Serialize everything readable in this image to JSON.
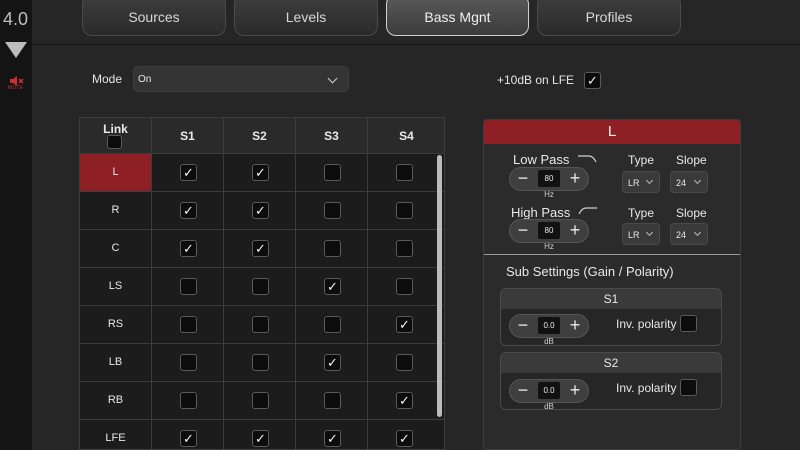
{
  "app": {
    "version": "4.0",
    "mute_label": "MUTE"
  },
  "tabs": [
    {
      "label": "Sources",
      "active": false
    },
    {
      "label": "Levels",
      "active": false
    },
    {
      "label": "Bass Mgnt",
      "active": true
    },
    {
      "label": "Profiles",
      "active": false
    }
  ],
  "mode": {
    "label": "Mode",
    "value": "On"
  },
  "lfe_boost": {
    "label": "+10dB on LFE",
    "checked": true
  },
  "grid": {
    "link_label": "Link",
    "columns": [
      "S1",
      "S2",
      "S3",
      "S4"
    ],
    "rows": [
      {
        "label": "L",
        "selected": true,
        "checks": [
          true,
          true,
          false,
          false
        ]
      },
      {
        "label": "R",
        "selected": false,
        "checks": [
          true,
          true,
          false,
          false
        ]
      },
      {
        "label": "C",
        "selected": false,
        "checks": [
          true,
          true,
          false,
          false
        ]
      },
      {
        "label": "LS",
        "selected": false,
        "checks": [
          false,
          false,
          true,
          false
        ]
      },
      {
        "label": "RS",
        "selected": false,
        "checks": [
          false,
          false,
          false,
          true
        ]
      },
      {
        "label": "LB",
        "selected": false,
        "checks": [
          false,
          false,
          true,
          false
        ]
      },
      {
        "label": "RB",
        "selected": false,
        "checks": [
          false,
          false,
          false,
          true
        ]
      },
      {
        "label": "LFE",
        "selected": false,
        "checks": [
          true,
          true,
          true,
          true
        ]
      }
    ]
  },
  "channel_panel": {
    "title": "L",
    "low_pass": {
      "label": "Low Pass",
      "value": "80",
      "unit": "Hz",
      "type_label": "Type",
      "type_value": "LR",
      "slope_label": "Slope",
      "slope_value": "24"
    },
    "high_pass": {
      "label": "High Pass",
      "value": "80",
      "unit": "Hz",
      "type_label": "Type",
      "type_value": "LR",
      "slope_label": "Slope",
      "slope_value": "24"
    },
    "sub_settings_title": "Sub Settings (Gain / Polarity)",
    "subs": [
      {
        "name": "S1",
        "gain": "0.0",
        "unit": "dB",
        "inv_label": "Inv. polarity",
        "inverted": false
      },
      {
        "name": "S2",
        "gain": "0.0",
        "unit": "dB",
        "inv_label": "Inv. polarity",
        "inverted": false
      }
    ]
  }
}
